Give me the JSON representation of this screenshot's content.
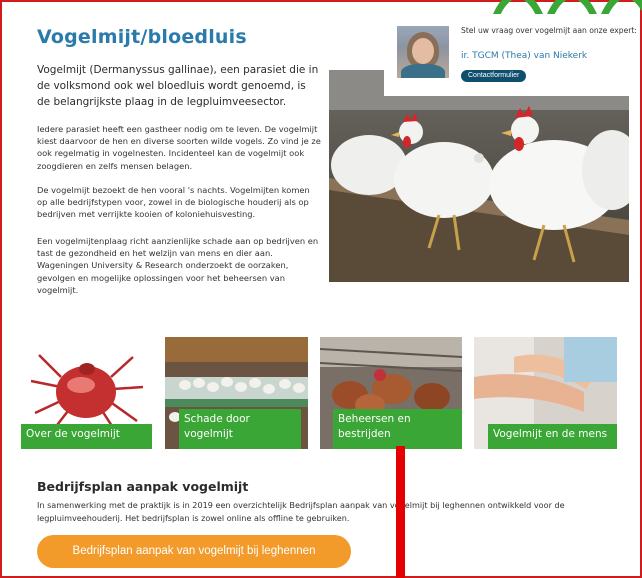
{
  "page": {
    "title": "Vogelmijt/bloedluis",
    "lead": "Vogelmijt (Dermanyssus gallinae), een parasiet die in de volksmond ook wel bloedluis wordt genoemd, is de belangrijkste plaag in de legpluimveesector.",
    "paragraphs": [
      "Iedere parasiet heeft een gastheer nodig om te leven. De vogelmijt kiest daarvoor de hen en diverse soorten wilde vogels. Zo vind je ze ook regelmatig in vogelnesten. Incidenteel kan de vogelmijt ook zoogdieren en zelfs mensen belagen.",
      "De vogelmijt bezoekt de hen vooral 's nachts. Vogelmijten komen op alle bedrijfstypen voor, zowel in de biologische houderij als op bedrijven met verrijkte kooien of koloniehuisvesting.",
      "Een vogelmijtenplaag richt aanzienlijke schade aan op bedrijven en tast de gezondheid en het welzijn van mens en dier aan. Wageningen University & Research onderzoekt de oorzaken, gevolgen en mogelijke oplossingen voor het beheersen van vogelmijt."
    ]
  },
  "expert": {
    "question": "Stel uw vraag over vogelmijt aan onze expert:",
    "name": "ir. TGCM (Thea) van Niekerk",
    "contact_label": "Contactformulier"
  },
  "tiles": [
    {
      "label": "Over de vogelmijt",
      "icon": "mite-image"
    },
    {
      "label": "Schade door vogelmijt",
      "icon": "eggs-conveyor-image"
    },
    {
      "label": "Beheersen en bestrijden",
      "icon": "hens-in-barn-image"
    },
    {
      "label": "Vogelmijt en de mens",
      "icon": "itching-arm-image"
    }
  ],
  "section": {
    "title": "Bedrijfsplan aanpak vogelmijt",
    "text": "In samenwerking met de praktijk is in 2019 een overzichtelijk Bedrijfsplan aanpak van vogelmijt bij leghennen ontwikkeld voor de legpluimveehouderij. Het bedrijfsplan is zowel online als offline te gebruiken.",
    "cta_label": "Bedrijfsplan aanpak van vogelmijt bij leghennen"
  },
  "colors": {
    "title_blue": "#2a7aab",
    "tile_green": "#3aa635",
    "cta_orange": "#f29a2a",
    "contact_navy": "#0f4f6e",
    "annotation_red": "#e40000"
  }
}
